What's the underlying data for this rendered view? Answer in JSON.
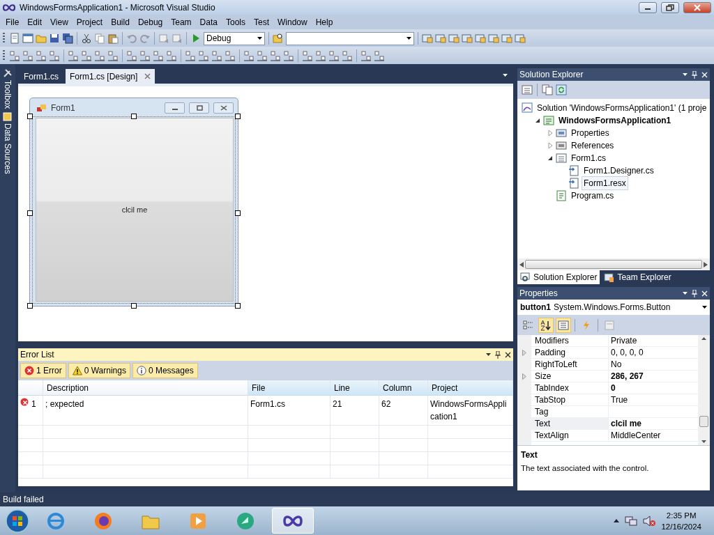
{
  "window": {
    "title": "WindowsFormsApplication1 - Microsoft Visual Studio"
  },
  "menu": [
    "File",
    "Edit",
    "View",
    "Project",
    "Build",
    "Debug",
    "Team",
    "Data",
    "Tools",
    "Test",
    "Window",
    "Help"
  ],
  "toolbar": {
    "configuration": "Debug"
  },
  "side_tabs": [
    "Toolbox",
    "Data Sources"
  ],
  "document_tabs": [
    {
      "label": "Form1.cs",
      "selected": false
    },
    {
      "label": "Form1.cs [Design]",
      "selected": true
    }
  ],
  "designer": {
    "form_title": "Form1",
    "button_text": "clcil me"
  },
  "error_list": {
    "title": "Error List",
    "filters": [
      {
        "kind": "error",
        "label": "1 Error",
        "selected": true
      },
      {
        "kind": "warning",
        "label": "0 Warnings",
        "selected": true
      },
      {
        "kind": "message",
        "label": "0 Messages",
        "selected": true
      }
    ],
    "columns": [
      "Description",
      "File",
      "Line",
      "Column",
      "Project"
    ],
    "rows": [
      {
        "kind": "error",
        "number": "1",
        "description": "; expected",
        "file": "Form1.cs",
        "line": "21",
        "column": "62",
        "project": "WindowsFormsApplication1"
      }
    ]
  },
  "solution_explorer": {
    "title": "Solution Explorer",
    "tree": [
      {
        "kind": "solution",
        "label": "Solution 'WindowsFormsApplication1' (1 proje",
        "selected": false,
        "children": [
          {
            "kind": "project",
            "label": "WindowsFormsApplication1",
            "expanded": true,
            "selected": false,
            "children": [
              {
                "kind": "properties",
                "label": "Properties",
                "expanded": false,
                "selected": false
              },
              {
                "kind": "references",
                "label": "References",
                "expanded": false,
                "selected": false
              },
              {
                "kind": "form",
                "label": "Form1.cs",
                "expanded": true,
                "selected": false,
                "children": [
                  {
                    "kind": "file",
                    "label": "Form1.Designer.cs",
                    "selected": false
                  },
                  {
                    "kind": "file",
                    "label": "Form1.resx",
                    "selected": true
                  }
                ]
              },
              {
                "kind": "code",
                "label": "Program.cs",
                "selected": false
              }
            ]
          }
        ]
      }
    ],
    "tabs": [
      {
        "label": "Solution Explorer",
        "selected": true
      },
      {
        "label": "Team Explorer",
        "selected": false
      }
    ]
  },
  "properties": {
    "title": "Properties",
    "object_name": "button1",
    "object_type": "System.Windows.Forms.Button",
    "view_buttons": [
      {
        "selected": false
      },
      {
        "selected": true
      },
      {
        "selected": true
      },
      {
        "selected": false
      },
      {
        "selected": false
      }
    ],
    "rows": [
      {
        "name": "Modifiers",
        "value": "Private",
        "modified": false,
        "selected": false
      },
      {
        "name": "Padding",
        "value": "0, 0, 0, 0",
        "expandable": true,
        "modified": false,
        "selected": false
      },
      {
        "name": "RightToLeft",
        "value": "No",
        "modified": false,
        "selected": false
      },
      {
        "name": "Size",
        "value": "286, 267",
        "expandable": true,
        "modified": true,
        "selected": false
      },
      {
        "name": "TabIndex",
        "value": "0",
        "modified": true,
        "selected": false
      },
      {
        "name": "TabStop",
        "value": "True",
        "modified": false,
        "selected": false
      },
      {
        "name": "Tag",
        "selected": false
      },
      {
        "name": "Text",
        "value": "clcil me",
        "modified": true,
        "selected": true
      },
      {
        "name": "TextAlign",
        "value": "MiddleCenter",
        "modified": false,
        "selected": false
      }
    ],
    "description": {
      "title": "Text",
      "text": "The text associated with the control."
    }
  },
  "status_bar": "Build failed",
  "taskbar": {
    "apps": [
      {
        "selected": false
      },
      {
        "selected": false
      },
      {
        "selected": false
      },
      {
        "selected": false
      },
      {
        "selected": false
      },
      {
        "selected": true
      }
    ],
    "time": "2:35 PM",
    "date": "12/16/2024"
  }
}
